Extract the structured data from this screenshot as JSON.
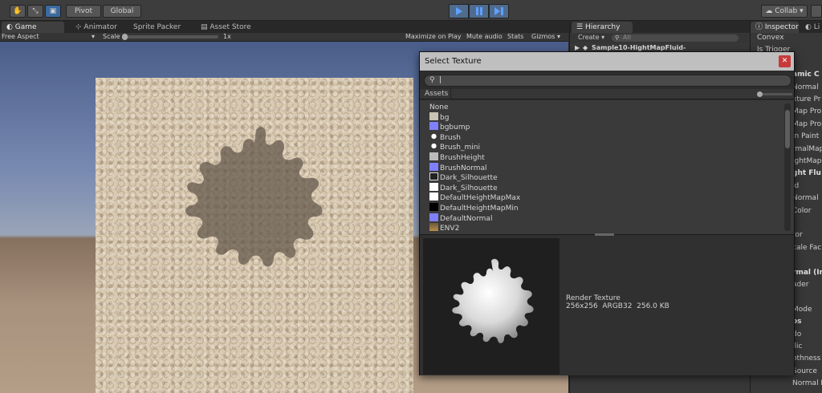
{
  "toolbar": {
    "pivot": "Pivot",
    "global": "Global",
    "collab": "Collab"
  },
  "game": {
    "tabs": [
      "Game",
      "Animator",
      "Sprite Packer",
      "Asset Store"
    ],
    "aspect": "Free Aspect",
    "scale_label": "Scale",
    "scale_value": "1x",
    "maximize": "Maximize on Play",
    "mute": "Mute audio",
    "stats": "Stats",
    "gizmos": "Gizmos"
  },
  "hierarchy": {
    "tab": "Hierarchy",
    "create": "Create",
    "search_placeholder": "All",
    "scene": "Sample10-HightMapFluid-"
  },
  "inspector": {
    "tab": "Inspector",
    "tab2": "Li",
    "rows": [
      "Convex",
      "Is Trigger",
      "",
      "amic C",
      "Normal",
      "xture Pr",
      "Map Pro",
      "Map Prop",
      "in Paint",
      "rmalMap",
      "ightMap",
      "ght Flu",
      "id",
      "Normal",
      "Color",
      "",
      "tor",
      "cale Fac",
      "",
      "rmal (In",
      "ader",
      "",
      "Mode",
      "os",
      "do",
      "llic",
      "othness",
      "Source",
      "Normal Map"
    ]
  },
  "dialog": {
    "title": "Select Texture",
    "search_value": "|",
    "assets_tab": "Assets",
    "items": [
      {
        "name": "None",
        "color": ""
      },
      {
        "name": "bg",
        "color": "#c9c3b5"
      },
      {
        "name": "bgbump",
        "color": "#8080ff"
      },
      {
        "name": "Brush",
        "color": "icon-white"
      },
      {
        "name": "Brush_mini",
        "color": "icon-white"
      },
      {
        "name": "BrushHeight",
        "color": "#bbbbbb"
      },
      {
        "name": "BrushNormal",
        "color": "#8080ff"
      },
      {
        "name": "Dark_Silhouette",
        "color": "icon-silhouette"
      },
      {
        "name": "Dark_Silhouette",
        "color": "#ffffff"
      },
      {
        "name": "DefaultHeightMapMax",
        "color": "#ffffff"
      },
      {
        "name": "DefaultHeightMapMin",
        "color": "#000000"
      },
      {
        "name": "DefaultNormal",
        "color": "#8080ff"
      },
      {
        "name": "ENV2",
        "color": "icon-env"
      }
    ],
    "preview": {
      "type": "Render Texture",
      "details": "256x256  ARGB32  256.0 KB"
    }
  }
}
